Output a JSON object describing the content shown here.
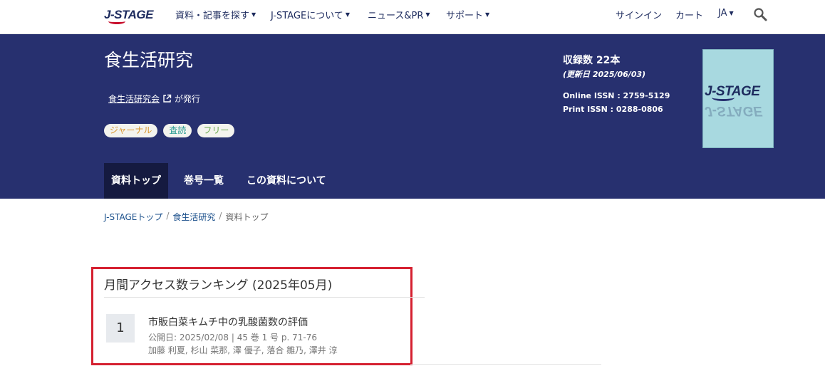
{
  "nav": {
    "logo": "J-STAGE",
    "items": [
      {
        "label": "資料・記事を探す",
        "has_caret": true
      },
      {
        "label": "J-STAGEについて",
        "has_caret": true
      },
      {
        "label": "ニュース&PR",
        "has_caret": true
      },
      {
        "label": "サポート",
        "has_caret": true
      }
    ],
    "signin": "サインイン",
    "cart": "カート",
    "lang": "JA",
    "search_icon": "magnifier-icon"
  },
  "journal": {
    "title": "食生活研究",
    "publisher_name": "食生活研究会",
    "publisher_suffix": "が発行",
    "tags": [
      "ジャーナル",
      "査読",
      "フリー"
    ],
    "count": "収録数 22本",
    "updated": "(更新日 2025/06/03)",
    "online_issn": "Online ISSN : 2759-5129",
    "print_issn": "Print ISSN : 0288-0806",
    "cover_logo": "J-STAGE"
  },
  "tabs": [
    {
      "label": "資料トップ",
      "active": true
    },
    {
      "label": "巻号一覧",
      "active": false
    },
    {
      "label": "この資料について",
      "active": false
    }
  ],
  "breadcrumb": {
    "home": "J-STAGEトップ",
    "sep": "/",
    "journal": "食生活研究",
    "current": "資料トップ"
  },
  "ranking": {
    "title": "月間アクセス数ランキング (2025年05月)",
    "items": [
      {
        "rank": "1",
        "title": "市販白菜キムチ中の乳酸菌数の評価",
        "meta": "公開日: 2025/02/08 | 45 巻 1 号 p. 71-76",
        "authors": "加藤 利夏, 杉山 菜那, 澤 優子, 落合 雛乃, 澤井 淳"
      }
    ]
  },
  "colors": {
    "banner": "#27306f",
    "active_tab": "#151a40",
    "highlight_border": "#d52030"
  }
}
